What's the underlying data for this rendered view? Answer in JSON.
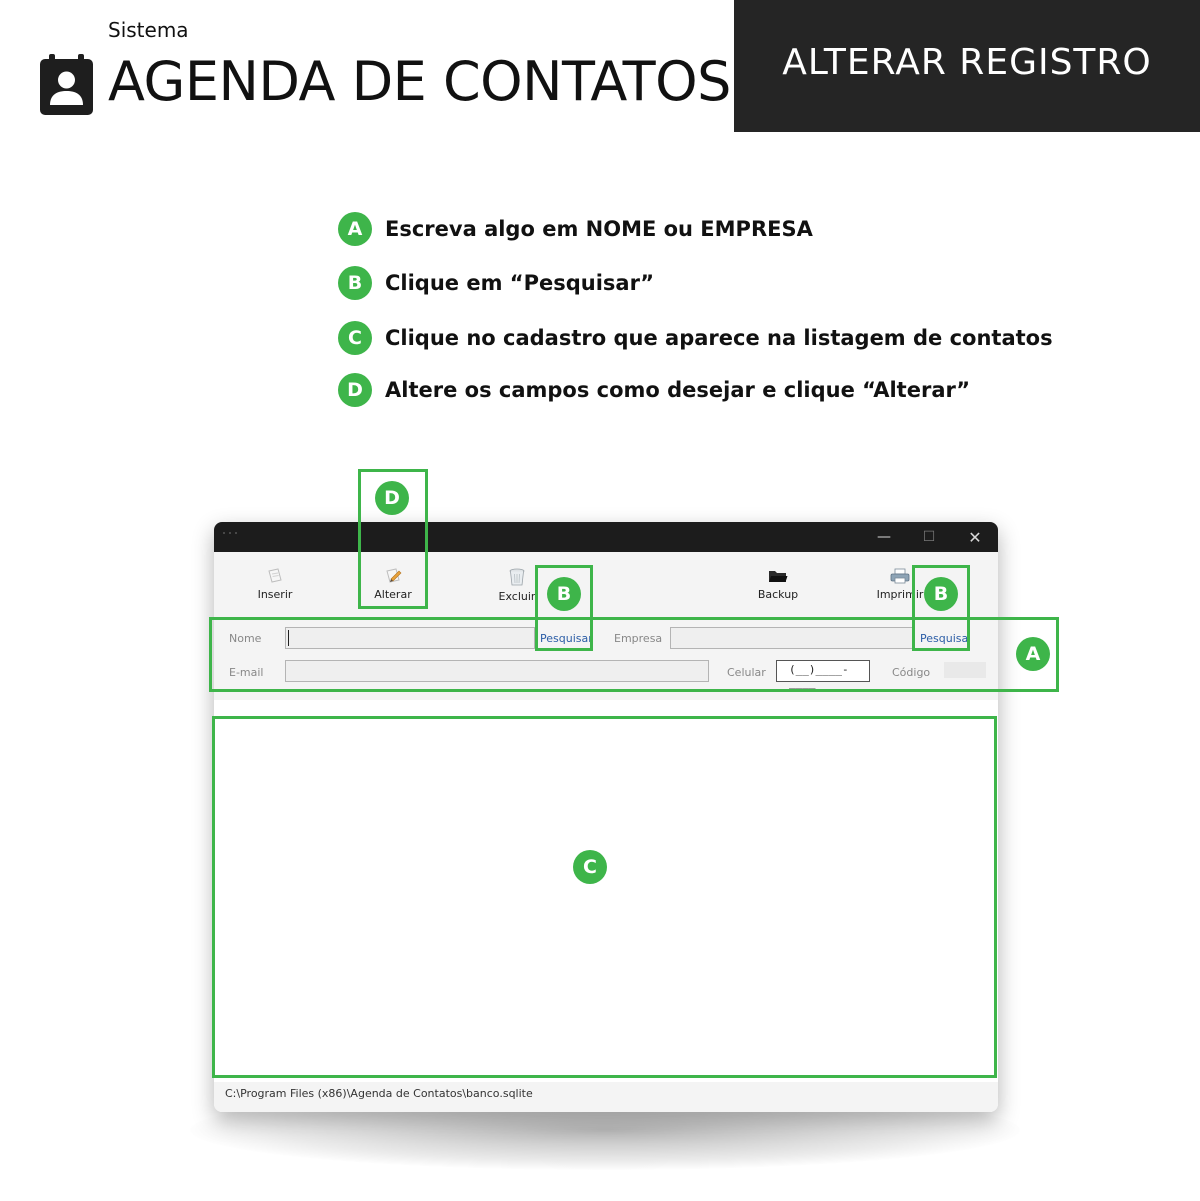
{
  "header": {
    "subtitle": "Sistema",
    "title": "AGENDA DE CONTATOS",
    "section": "ALTERAR REGISTRO",
    "icon": "contact-book-icon"
  },
  "steps": [
    {
      "letter": "A",
      "text": "Escreva algo em NOME ou EMPRESA"
    },
    {
      "letter": "B",
      "text": "Clique em “Pesquisar”"
    },
    {
      "letter": "C",
      "text": "Clique no cadastro que aparece na listagem de contatos"
    },
    {
      "letter": "D",
      "text": "Altere os campos como desejar e clique “Alterar”"
    }
  ],
  "window": {
    "controls": {
      "minimize": "—",
      "maximize": "☐",
      "close": "✕"
    },
    "toolbar": {
      "insert": "Inserir",
      "edit": "Alterar",
      "delete": "Excluir",
      "backup": "Backup",
      "print": "Imprimir"
    },
    "form": {
      "name_label": "Nome",
      "name_value": "",
      "search_name": "Pesquisar",
      "company_label": "Empresa",
      "company_value": "",
      "search_company": "Pesquisar",
      "email_label": "E-mail",
      "email_value": "",
      "mobile_label": "Celular",
      "mobile_mask": "(__)____-____",
      "code_label": "Código",
      "code_value": ""
    },
    "contacts": [],
    "status_path": "C:\\Program Files (x86)\\Agenda de Contatos\\banco.sqlite"
  },
  "annotations": {
    "A": "A",
    "B": "B",
    "C": "C",
    "D": "D"
  },
  "colors": {
    "accent_green": "#3eb54a",
    "header_band": "#252525",
    "link_blue": "#2b5da6"
  }
}
